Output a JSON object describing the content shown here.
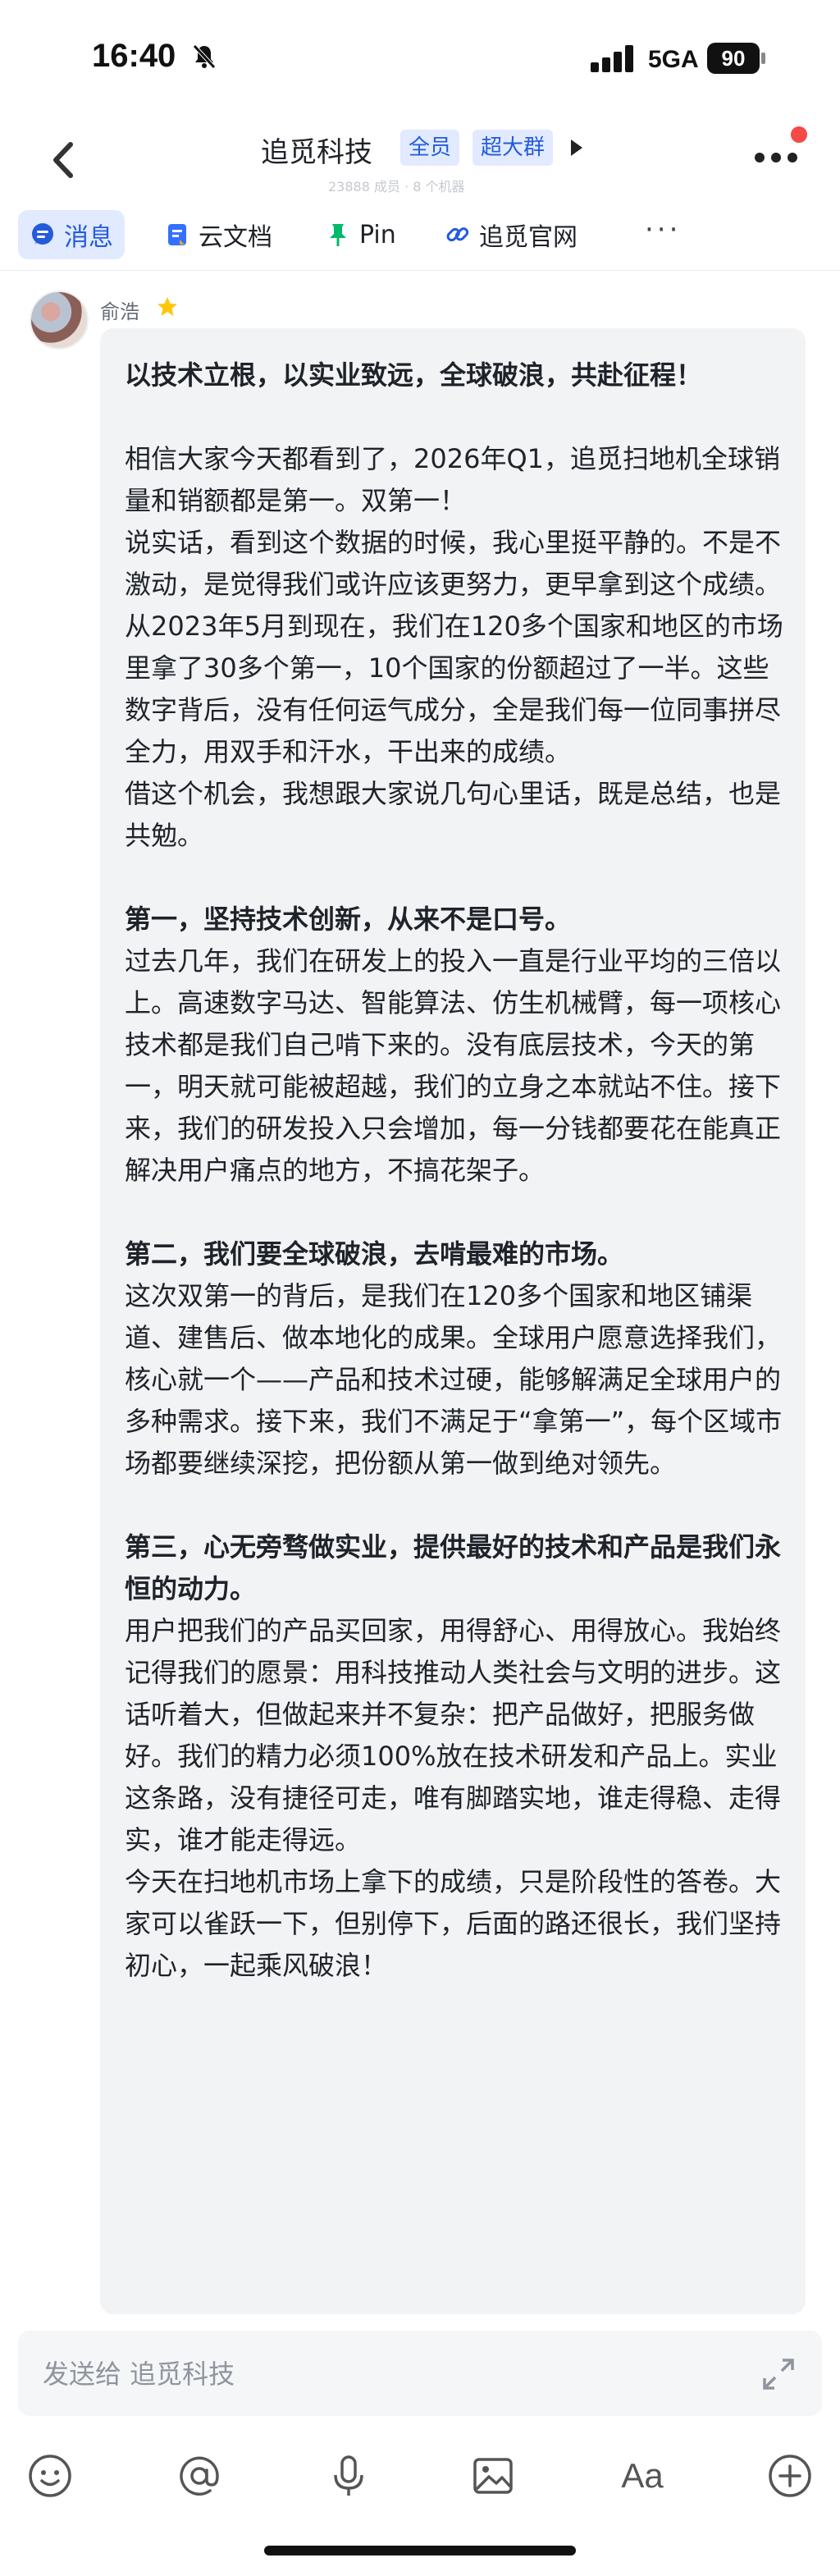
{
  "status_bar": {
    "time": "16:40",
    "network": "5GA",
    "battery": "90"
  },
  "header": {
    "title": "追觅科技",
    "badges": [
      "全员",
      "超大群"
    ],
    "subtitle": "23888 成员 · 8 个机器"
  },
  "tabs": [
    {
      "label": "消息",
      "icon": "chat-bubble-icon",
      "active": true
    },
    {
      "label": "云文档",
      "icon": "doc-icon",
      "active": false
    },
    {
      "label": "Pin",
      "icon": "pin-icon",
      "active": false
    },
    {
      "label": "追觅官网",
      "icon": "link-icon",
      "active": false
    },
    {
      "label": "···",
      "icon": "more-icon",
      "active": false
    }
  ],
  "message": {
    "sender": "俞浩",
    "sender_badge": "star-icon",
    "paragraphs": [
      {
        "text": "以技术立根，以实业致远，全球破浪，共赴征程！",
        "bold": true
      },
      {
        "text": "",
        "bold": false
      },
      {
        "text": "相信大家今天都看到了，2026年Q1，追觅扫地机全球销量和销额都是第一。双第一！",
        "bold": false
      },
      {
        "text": "说实话，看到这个数据的时候，我心里挺平静的。不是不激动，是觉得我们或许应该更努力，更早拿到这个成绩。从2023年5月到现在，我们在120多个国家和地区的市场里拿了30多个第一，10个国家的份额超过了一半。这些数字背后，没有任何运气成分，全是我们每一位同事拼尽全力，用双手和汗水，干出来的成绩。",
        "bold": false
      },
      {
        "text": "借这个机会，我想跟大家说几句心里话，既是总结，也是共勉。",
        "bold": false
      },
      {
        "text": "",
        "bold": false
      },
      {
        "text": "第一，坚持技术创新，从来不是口号。",
        "bold": true
      },
      {
        "text": "过去几年，我们在研发上的投入一直是行业平均的三倍以上。高速数字马达、智能算法、仿生机械臂，每一项核心技术都是我们自己啃下来的。没有底层技术，今天的第一，明天就可能被超越，我们的立身之本就站不住。接下来，我们的研发投入只会增加，每一分钱都要花在能真正解决用户痛点的地方，不搞花架子。",
        "bold": false
      },
      {
        "text": "",
        "bold": false
      },
      {
        "text": "第二，我们要全球破浪，去啃最难的市场。",
        "bold": true
      },
      {
        "text": "这次双第一的背后，是我们在120多个国家和地区铺渠道、建售后、做本地化的成果。全球用户愿意选择我们，核心就一个——产品和技术过硬，能够解满足全球用户的多种需求。接下来，我们不满足于“拿第一”，每个区域市场都要继续深挖，把份额从第一做到绝对领先。",
        "bold": false
      },
      {
        "text": "",
        "bold": false
      },
      {
        "text": "第三，心无旁骛做实业，提供最好的技术和产品是我们永恒的动力。",
        "bold": true
      },
      {
        "text": "用户把我们的产品买回家，用得舒心、用得放心。我始终记得我们的愿景：用科技推动人类社会与文明的进步。这话听着大，但做起来并不复杂：把产品做好，把服务做好。我们的精力必须100%放在技术研发和产品上。实业这条路，没有捷径可走，唯有脚踏实地，谁走得稳、走得实，谁才能走得远。",
        "bold": false
      },
      {
        "text": "今天在扫地机市场上拿下的成绩，只是阶段性的答卷。大家可以雀跃一下，但别停下，后面的路还很长，我们坚持初心，一起乘风破浪！",
        "bold": false
      }
    ]
  },
  "composer": {
    "placeholder": "发送给 追觅科技",
    "tools": [
      "emoji-icon",
      "at-icon",
      "microphone-icon",
      "image-icon",
      "font-icon",
      "plus-icon"
    ],
    "font_label": "Aa"
  },
  "colors": {
    "accent": "#245bdb",
    "accent_bg": "#e1eaff",
    "bubble_bg": "#f2f3f5",
    "notification_dot": "#f54a45"
  }
}
